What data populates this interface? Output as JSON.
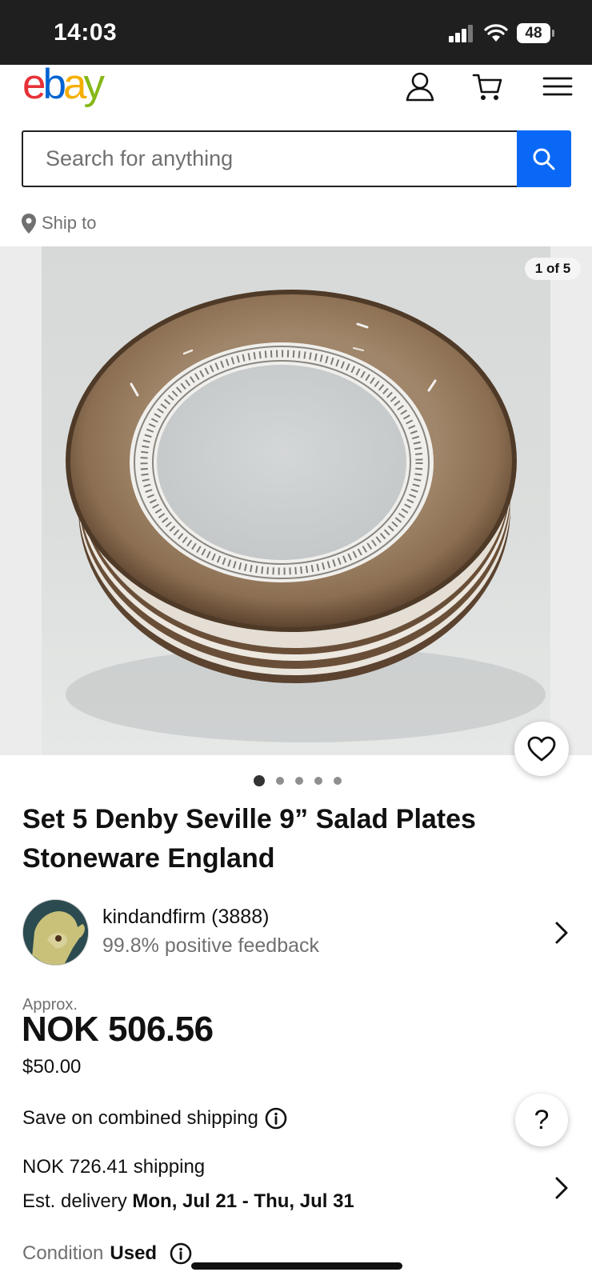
{
  "status_bar": {
    "time": "14:03",
    "battery": "48"
  },
  "header": {
    "logo": {
      "letters": [
        "e",
        "b",
        "a",
        "y"
      ],
      "colors": [
        "#e53238",
        "#0064d2",
        "#f5af02",
        "#86b817"
      ]
    },
    "icons": [
      "account-icon",
      "cart-icon",
      "menu-icon"
    ]
  },
  "search": {
    "placeholder": "Search for anything",
    "button_color": "#0968f6"
  },
  "ship_to": {
    "label": "Ship to"
  },
  "gallery": {
    "counter": "1 of 5",
    "total_images": 5,
    "active_index": 0
  },
  "listing": {
    "title": "Set 5 Denby Seville 9” Salad Plates Stoneware England"
  },
  "seller": {
    "name": "kindandfirm (3888)",
    "feedback": "99.8% positive feedback"
  },
  "price": {
    "approx_label": "Approx.",
    "converted": "NOK 506.56",
    "original": "$50.00"
  },
  "shipping": {
    "combined_label": "Save on combined shipping",
    "cost": "NOK 726.41 shipping",
    "delivery_label": "Est. delivery",
    "delivery_dates": "Mon, Jul 21 - Thu, Jul 31"
  },
  "condition": {
    "label": "Condition",
    "value": "Used"
  },
  "help": {
    "label": "?"
  }
}
